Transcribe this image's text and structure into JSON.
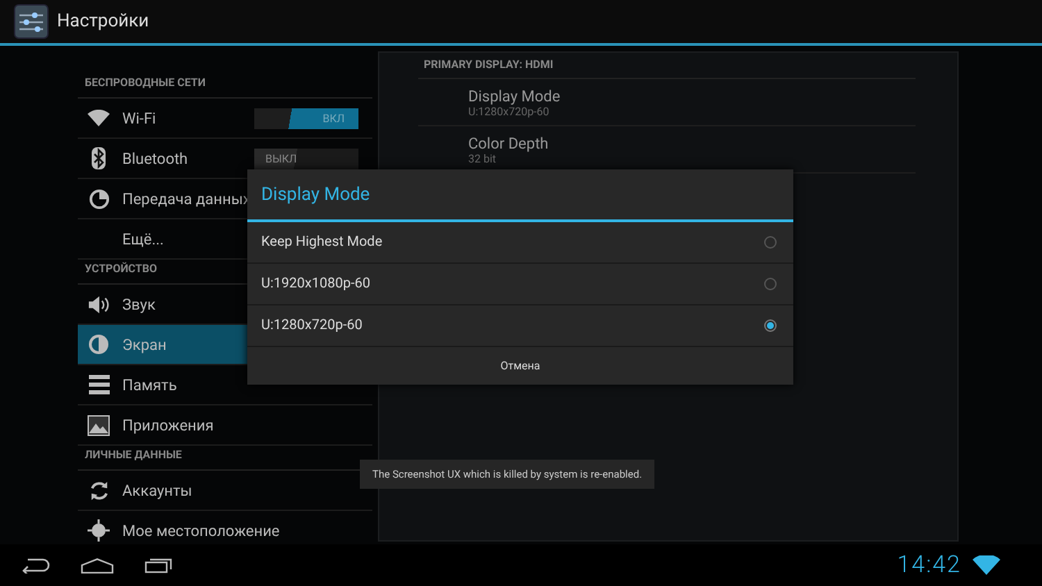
{
  "action_bar": {
    "title": "Настройки"
  },
  "sidebar": {
    "sections": [
      {
        "header": "БЕСПРОВОДНЫЕ СЕТИ",
        "items": [
          {
            "label": "Wi-Fi",
            "selected": false,
            "toggle": {
              "label": "ВКЛ",
              "on": true
            }
          },
          {
            "label": "Bluetooth",
            "selected": false,
            "toggle": {
              "label": "ВЫКЛ",
              "on": false
            }
          },
          {
            "label": "Передача данных",
            "selected": false
          },
          {
            "label": "Ещё...",
            "selected": false
          }
        ]
      },
      {
        "header": "УСТРОЙСТВО",
        "items": [
          {
            "label": "Звук",
            "selected": false
          },
          {
            "label": "Экран",
            "selected": true
          },
          {
            "label": "Память",
            "selected": false
          },
          {
            "label": "Приложения",
            "selected": false
          }
        ]
      },
      {
        "header": "ЛИЧНЫЕ ДАННЫЕ",
        "items": [
          {
            "label": "Аккаунты",
            "selected": false
          },
          {
            "label": "Мое местоположение",
            "selected": false
          }
        ]
      }
    ]
  },
  "detail": {
    "header": "PRIMARY DISPLAY: HDMI",
    "items": [
      {
        "title": "Display Mode",
        "summary": "U:1280x720p-60"
      },
      {
        "title": "Color Depth",
        "summary": "32 bit"
      }
    ]
  },
  "dialog": {
    "title": "Display Mode",
    "options": [
      {
        "label": "Keep Highest Mode",
        "selected": false
      },
      {
        "label": "U:1920x1080p-60",
        "selected": false
      },
      {
        "label": "U:1280x720p-60",
        "selected": true
      }
    ],
    "cancel": "Отмена"
  },
  "toast": {
    "text": "The Screenshot UX which is killed by system is re-enabled."
  },
  "status_bar": {
    "time": "14:42"
  }
}
